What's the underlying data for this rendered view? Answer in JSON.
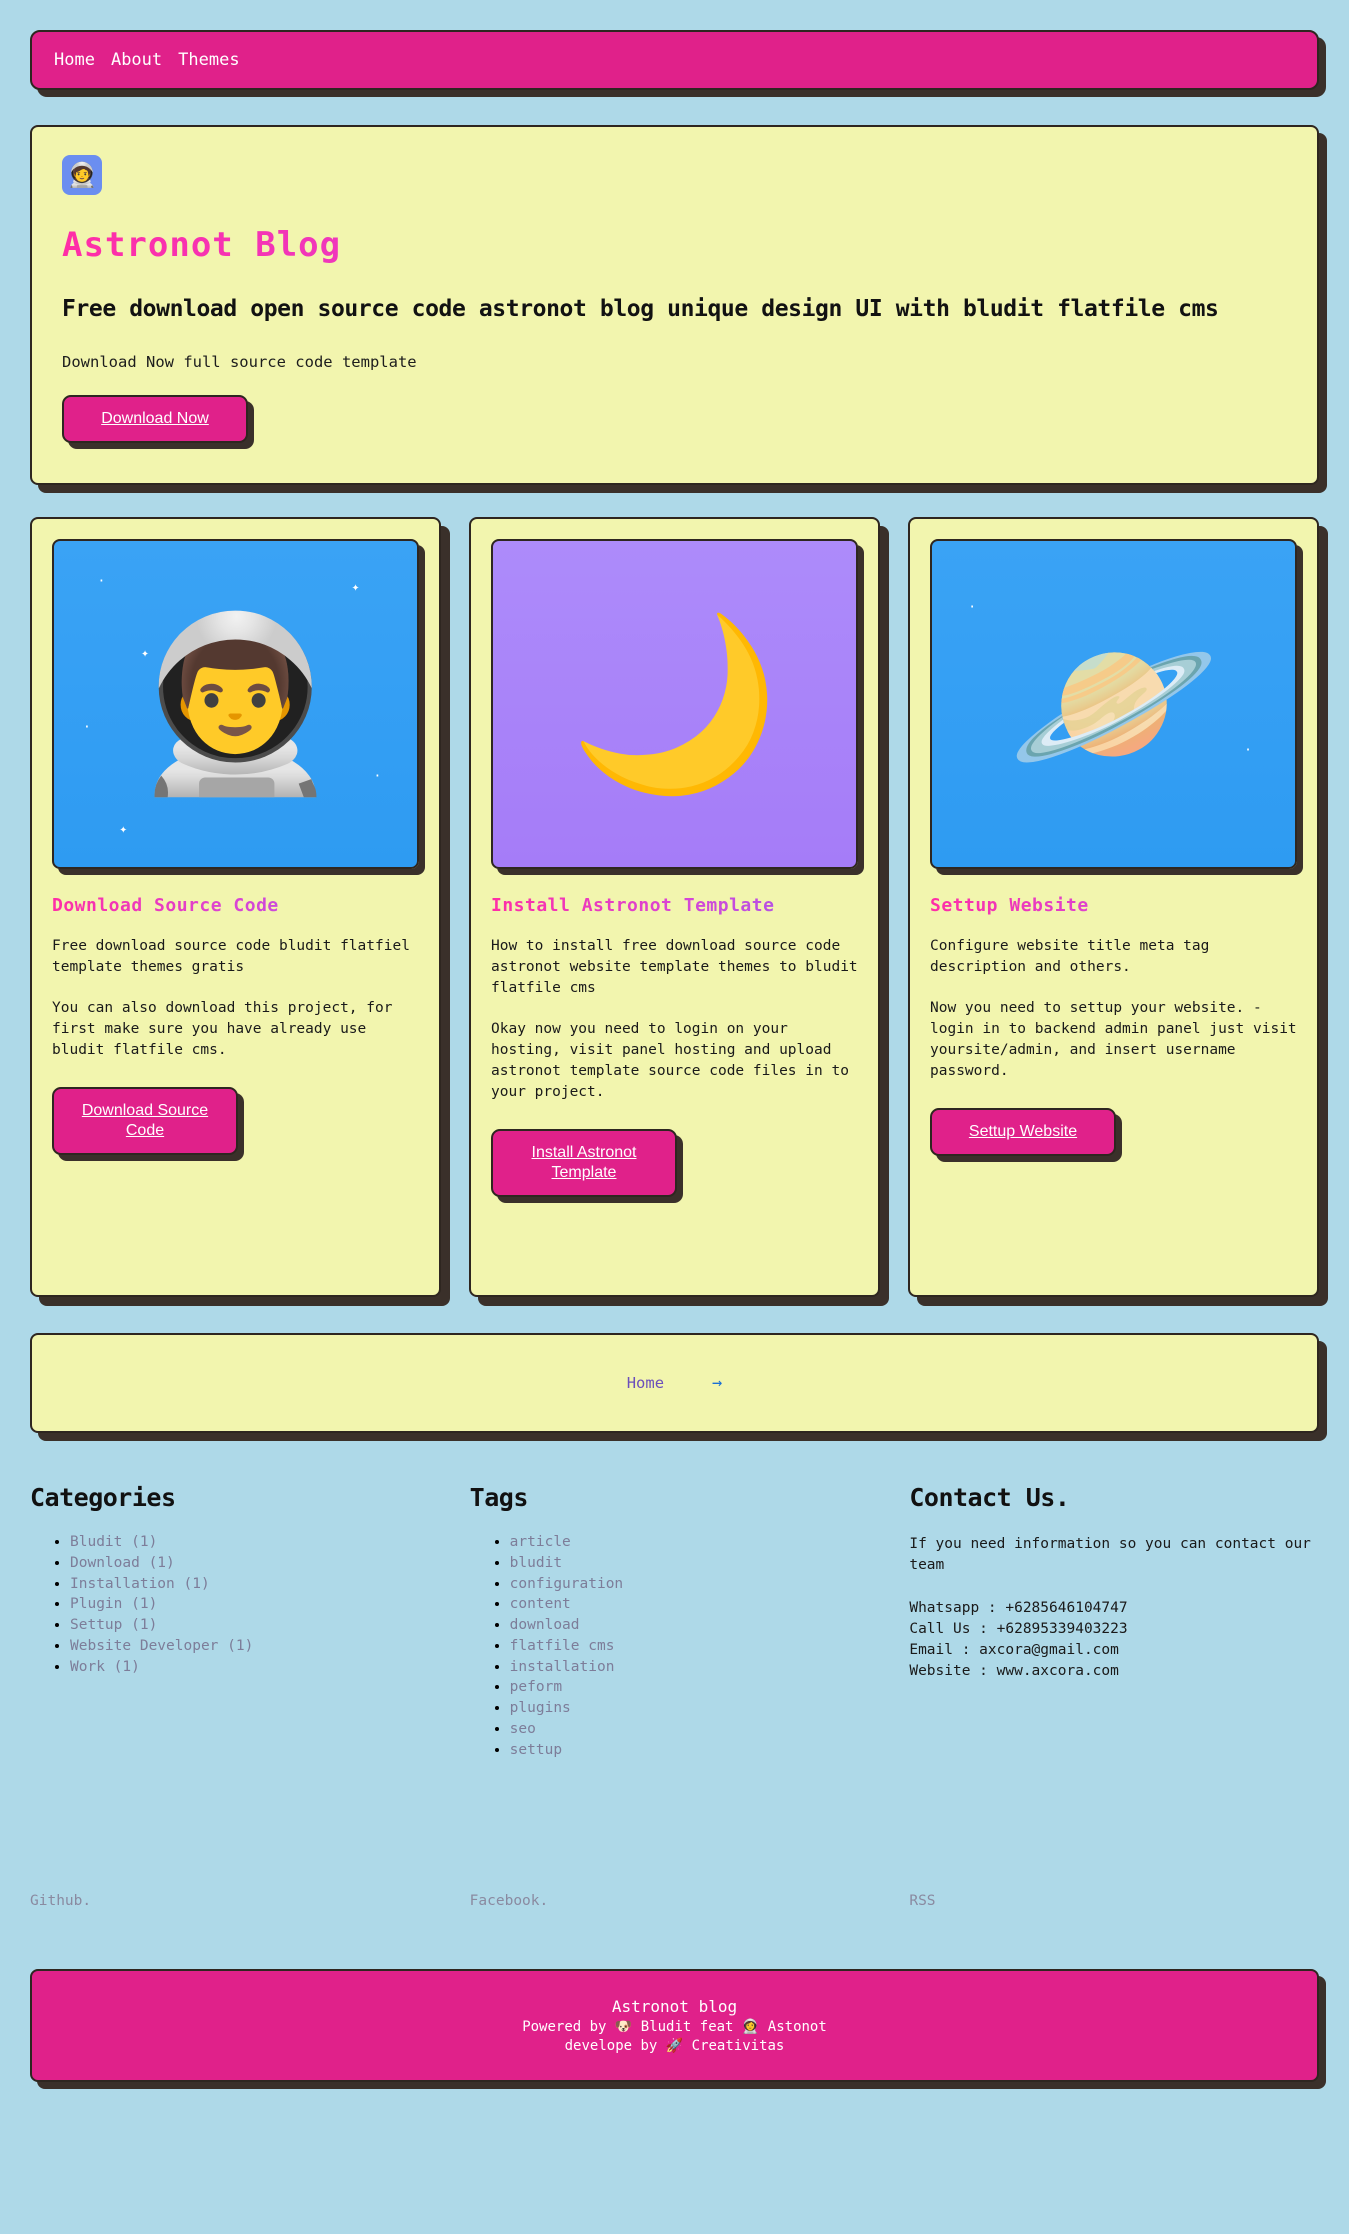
{
  "theme": {
    "page_bg": "#aed9e8",
    "panel_bg": "#f2f5ae",
    "accent_pink": "#e0218a",
    "shadow": "#3a302a",
    "border": "#2e2620",
    "link_muted": "#7d7d99"
  },
  "nav": {
    "items": [
      {
        "label": "Home"
      },
      {
        "label": "About"
      },
      {
        "label": "Themes"
      }
    ]
  },
  "hero": {
    "avatar_icon": "astronaut-icon",
    "avatar_glyph": "🧑‍🚀",
    "title": "Astronot Blog",
    "subtitle": "Free download open source code astronot blog unique design UI with bludit flatfile cms",
    "description": "Download Now full source code template",
    "button_label": "Download Now"
  },
  "cards": [
    {
      "image_icon": "astronaut-floating-icon",
      "image_glyph": "👨‍🚀",
      "image_bg": "blue",
      "title": "Download Source Code",
      "paragraphs": [
        "Free download source code bludit flatfiel template themes gratis",
        "You can also download this project, for first make sure you have already use bludit flatfile cms."
      ],
      "button_label": "Download Source Code"
    },
    {
      "image_icon": "astronaut-moon-skate-icon",
      "image_glyph": "🌙",
      "image_bg": "purple",
      "title": "Install Astronot Template",
      "paragraphs": [
        "How to install free download source code astronot website template themes to bludit flatfile cms",
        "Okay now you need to login on your hosting, visit panel hosting and upload astronot template source code files in to your project."
      ],
      "button_label": "Install Astronot Template"
    },
    {
      "image_icon": "astronaut-planet-icon",
      "image_glyph": "🪐",
      "image_bg": "blue",
      "title": "Settup Website",
      "paragraphs": [
        "Configure website title meta tag description and others.",
        "Now you need to settup your website. - login in to backend admin panel just visit yoursite/admin, and insert username password."
      ],
      "button_label": "Settup Website"
    }
  ],
  "pagination": {
    "home_label": "Home",
    "next_label": "→"
  },
  "footer_columns": {
    "categories": {
      "heading": "Categories",
      "items": [
        "Bludit (1)",
        "Download (1)",
        "Installation (1)",
        "Plugin (1)",
        "Settup (1)",
        "Website Developer (1)",
        "Work (1)"
      ]
    },
    "tags": {
      "heading": "Tags",
      "items": [
        "article",
        "bludit",
        "configuration",
        "content",
        "download",
        "flatfile cms",
        "installation",
        "peform",
        "plugins",
        "seo",
        "settup"
      ]
    },
    "contact": {
      "heading": "Contact Us.",
      "intro": "If you need information so you can contact our team",
      "lines": [
        "Whatsapp : +6285646104747",
        "Call Us : +62895339403223",
        "Email : axcora@gmail.com",
        "Website : www.axcora.com"
      ]
    }
  },
  "social": {
    "github": "Github.",
    "facebook": "Facebook.",
    "rss": "RSS"
  },
  "bottom_bar": {
    "title": "Astronot blog",
    "powered_prefix": "Powered by ",
    "powered_icon_1": "🐶",
    "powered_mid": " Bludit feat ",
    "powered_icon_2": "👩‍🚀",
    "powered_suffix": " Astonot",
    "develop_prefix": "develope by ",
    "develop_icon": "🚀",
    "develop_suffix": " Creativitas"
  }
}
